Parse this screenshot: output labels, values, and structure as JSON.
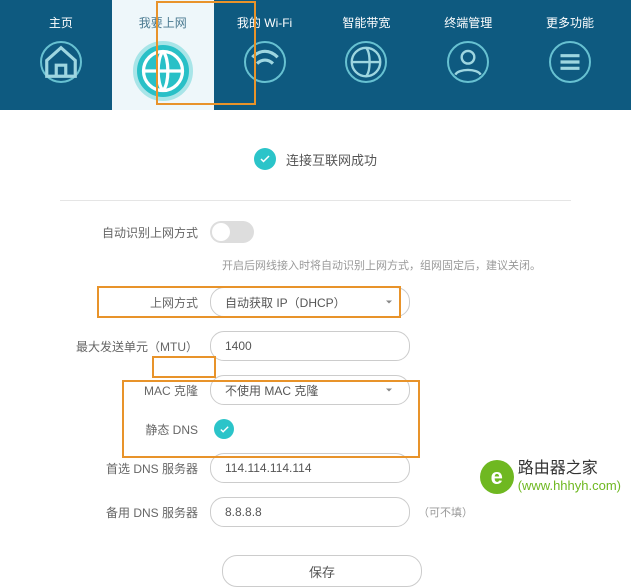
{
  "nav": {
    "home": "主页",
    "internet": "我要上网",
    "wifi": "我的 Wi-Fi",
    "bandwidth": "智能带宽",
    "terminal": "终端管理",
    "more": "更多功能"
  },
  "status": {
    "connected": "连接互联网成功"
  },
  "form": {
    "auto_detect_label": "自动识别上网方式",
    "auto_detect_hint": "开启后网线接入时将自动识别上网方式，组网固定后，建议关闭。",
    "method_label": "上网方式",
    "method_value": "自动获取 IP（DHCP）",
    "mtu_label": "最大发送单元（MTU）",
    "mtu_value": "1400",
    "mac_label": "MAC 克隆",
    "mac_value": "不使用 MAC 克隆",
    "static_dns_label": "静态 DNS",
    "dns1_label": "首选 DNS 服务器",
    "dns1_value": "114.114.114.114",
    "dns2_label": "备用 DNS 服务器",
    "dns2_value": "8.8.8.8",
    "optional": "（可不填）",
    "save": "保存"
  },
  "watermark": {
    "title": "路由器之家",
    "url": "(www.hhhyh.com)"
  }
}
